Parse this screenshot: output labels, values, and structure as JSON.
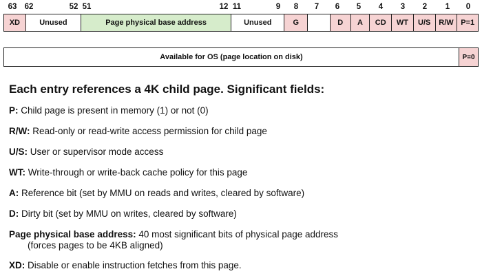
{
  "bit_numbers": [
    "63",
    "62",
    "52",
    "51",
    "12",
    "11",
    "9",
    "8",
    "7",
    "6",
    "5",
    "4",
    "3",
    "2",
    "1",
    "0"
  ],
  "entry_fields": [
    "XD",
    "Unused",
    "Page physical base address",
    "Unused",
    "G",
    "",
    "D",
    "A",
    "CD",
    "WT",
    "U/S",
    "R/W",
    "P=1"
  ],
  "os_entry": {
    "available": "Available for OS (page location on disk)",
    "present": "P=0"
  },
  "heading": "Each entry references a 4K child page. Significant fields:",
  "fields": [
    {
      "name": "P:",
      "desc": " Child page is present in memory (1) or not (0)"
    },
    {
      "name": "R/W:",
      "desc": " Read-only or read-write access permission for child page"
    },
    {
      "name": "U/S:",
      "desc": " User or supervisor mode access"
    },
    {
      "name": "WT:",
      "desc": " Write-through or write-back cache policy for this page"
    },
    {
      "name": "A:",
      "desc": " Reference bit (set by MMU on reads and writes, cleared by software)"
    },
    {
      "name": "D:",
      "desc": " Dirty bit (set by MMU on writes, cleared by software)"
    },
    {
      "name": "Page physical base address:",
      "desc": " 40 most significant bits of physical page address",
      "cont": "(forces pages to be 4KB aligned)"
    },
    {
      "name": "XD:",
      "desc": " Disable or enable instruction fetches from this page."
    }
  ]
}
